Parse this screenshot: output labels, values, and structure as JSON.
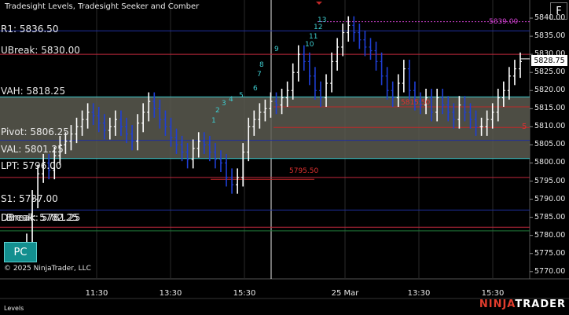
{
  "window": {
    "title": "Tradesight Levels, Tradesight Seeker and Comber"
  },
  "buttons": {
    "pc": "PC",
    "f": "F"
  },
  "copyright": "© 2025 NinjaTrader, LLC",
  "bottom_label": "Levels",
  "brand": {
    "part1": "NINJA",
    "part2": "TRADER"
  },
  "colors": {
    "background": "#000000",
    "up_bar": "#ffffff",
    "down_bar": "#1f3fd6",
    "value_area": "#5a5a50",
    "level_blue": "#1e2fa0",
    "level_red": "#c0283c",
    "level_cyan": "#3ecdd0",
    "level_green": "#1f7a3a",
    "magenta": "#d040d0",
    "seeker_cyan": "#3ecdd0",
    "seeker_green": "#2fa83b"
  },
  "levels": [
    {
      "label": "R1: 5836.50",
      "price": 5836.5,
      "color": "#1e2fa0"
    },
    {
      "label": "UBreak: 5830.00",
      "price": 5830.0,
      "color": "#c0283c"
    },
    {
      "label": "VAH: 5818.25",
      "price": 5818.25,
      "color": "#3ecdd0"
    },
    {
      "label": "Pivot: 5806.25",
      "price": 5806.25,
      "color": "#1e2fa0"
    },
    {
      "label": "VAL: 5801.25",
      "price": 5801.25,
      "color": "#3ecdd0"
    },
    {
      "label": "LPT: 5796.00",
      "price": 5796.0,
      "color": "#c0283c"
    },
    {
      "label": "S1: 5787.00",
      "price": 5787.0,
      "color": "#1e2fa0"
    },
    {
      "label": "LBreak: 5782.25",
      "price": 5782.25,
      "color": "#c0283c"
    },
    {
      "label": "DBreak: 5781.25",
      "price": 5781.25,
      "color": "#1f7a3a"
    }
  ],
  "annotations": {
    "level_5839": "5839.00",
    "level_5815": "5815.50",
    "level_5795": "5795.50",
    "marker_5": "5"
  },
  "y_axis": {
    "ticks": [
      "5840.00",
      "5835.00",
      "5830.00",
      "5825.00",
      "5820.00",
      "5815.00",
      "5810.00",
      "5805.00",
      "5800.00",
      "5795.00",
      "5790.00",
      "5785.00",
      "5780.00",
      "5775.00",
      "5770.00"
    ]
  },
  "current_price": "5828.75",
  "x_axis": {
    "ticks": [
      "11:30",
      "13:30",
      "15:30",
      "25 Mar",
      "13:30",
      "15:30"
    ]
  },
  "seeker_numbers": [
    "1",
    "2",
    "3",
    "4",
    "5",
    "6",
    "7",
    "8",
    "9",
    "10",
    "11",
    "12",
    "13"
  ],
  "chart_data": {
    "type": "bar",
    "title": "Tradesight Levels, Tradesight Seeker and Comber",
    "ylim": [
      5768,
      5845
    ],
    "y_ticks": [
      5840,
      5835,
      5830,
      5825,
      5820,
      5815,
      5810,
      5805,
      5800,
      5795,
      5790,
      5785,
      5780,
      5775,
      5770
    ],
    "x_ticks": [
      "11:30",
      "13:30",
      "15:30",
      "25 Mar",
      "13:30",
      "15:30"
    ],
    "last_price": 5828.75,
    "levels": {
      "R1": 5836.5,
      "UBreak": 5830.0,
      "VAH": 5818.25,
      "Pivot": 5806.25,
      "VAL": 5801.25,
      "LPT": 5796.0,
      "S1": 5787.0,
      "LBreak": 5782.25,
      "DBreak": 5781.25
    },
    "closes": [
      5778,
      5790,
      5797,
      5800,
      5798,
      5802,
      5805,
      5806,
      5808,
      5810,
      5812,
      5814,
      5813,
      5811,
      5809,
      5810,
      5812,
      5810,
      5808,
      5806,
      5811,
      5814,
      5817,
      5815,
      5812,
      5810,
      5807,
      5805,
      5803,
      5801,
      5804,
      5806,
      5805,
      5803,
      5801,
      5800,
      5796,
      5794,
      5796,
      5803,
      5810,
      5812,
      5814,
      5815,
      5817,
      5816,
      5818,
      5820,
      5825,
      5830,
      5828,
      5824,
      5820,
      5818,
      5822,
      5828,
      5832,
      5836,
      5838,
      5836,
      5834,
      5832,
      5831,
      5828,
      5824,
      5820,
      5818,
      5822,
      5826,
      5820,
      5817,
      5816,
      5818,
      5814,
      5818,
      5816,
      5814,
      5812,
      5816,
      5814,
      5812,
      5810,
      5810,
      5812,
      5814,
      5818,
      5820,
      5824,
      5826,
      5828
    ]
  }
}
